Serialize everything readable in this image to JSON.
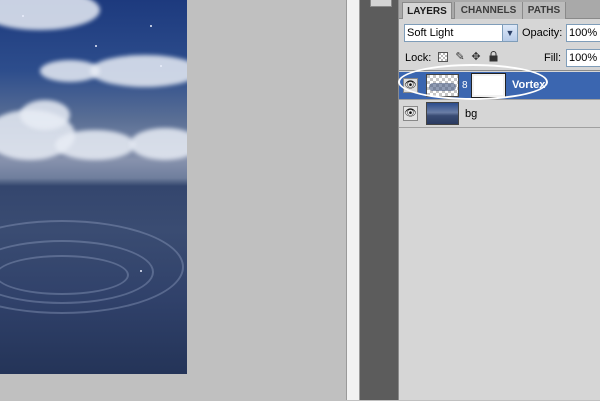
{
  "panel": {
    "tabs": [
      {
        "label": "LAYERS",
        "active": true
      },
      {
        "label": "CHANNELS",
        "active": false
      },
      {
        "label": "PATHS",
        "active": false
      }
    ],
    "blend_mode": {
      "value": "Soft Light"
    },
    "opacity": {
      "label": "Opacity:",
      "value": "100%"
    },
    "lock": {
      "label": "Lock:"
    },
    "fill": {
      "label": "Fill:",
      "value": "100%"
    },
    "layers": [
      {
        "name": "Vortex",
        "selected": true,
        "visible": true,
        "has_mask": true
      },
      {
        "name": "bg",
        "selected": false,
        "visible": true,
        "has_mask": false
      }
    ]
  },
  "icons": {
    "visibility": "eye-icon",
    "link": "chain-icon",
    "lock_transparent": "checkerboard-icon",
    "lock_image": "brush-icon",
    "lock_position": "move-icon",
    "lock_all": "padlock-icon",
    "dropdown": "chevron-down-icon"
  },
  "colors": {
    "selected_row": "#3b66b0",
    "panel_bg": "#d6d6d6",
    "sidebar_dark": "#5c5c5c",
    "highlight_ellipse": "#ffffff"
  }
}
